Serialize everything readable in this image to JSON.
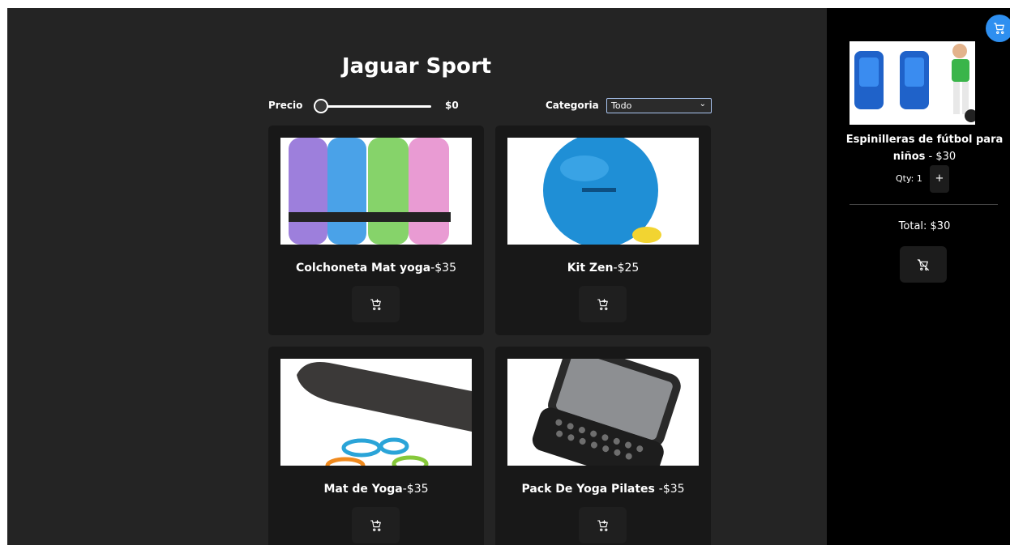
{
  "header": {
    "title": "Jaguar Sport"
  },
  "filters": {
    "price_label": "Precio",
    "price_value": "$0",
    "price_fraction": 0,
    "category_label": "Categoria",
    "category_selected": "Todo"
  },
  "products": [
    {
      "name": "Colchoneta Mat yoga",
      "price": "-$35",
      "image": "yoga-mats"
    },
    {
      "name": "Kit Zen",
      "price": "-$25",
      "image": "exercise-ball"
    },
    {
      "name": "Mat de Yoga",
      "price": "-$35",
      "image": "yoga-mat-bands"
    },
    {
      "name": "Pack De Yoga Pilates ",
      "price": "-$35",
      "image": "phone"
    }
  ],
  "cart": {
    "item_name_line1": "Espinilleras de fútbol para",
    "item_name_line2": "niños",
    "item_price": " - $30",
    "qty_label": "Qty: 1",
    "plus_label": "+",
    "total": "Total: $30"
  },
  "colors": {
    "accent": "#2e8ff0",
    "background": "#242424",
    "card": "#181818",
    "sidebar": "#000000"
  }
}
